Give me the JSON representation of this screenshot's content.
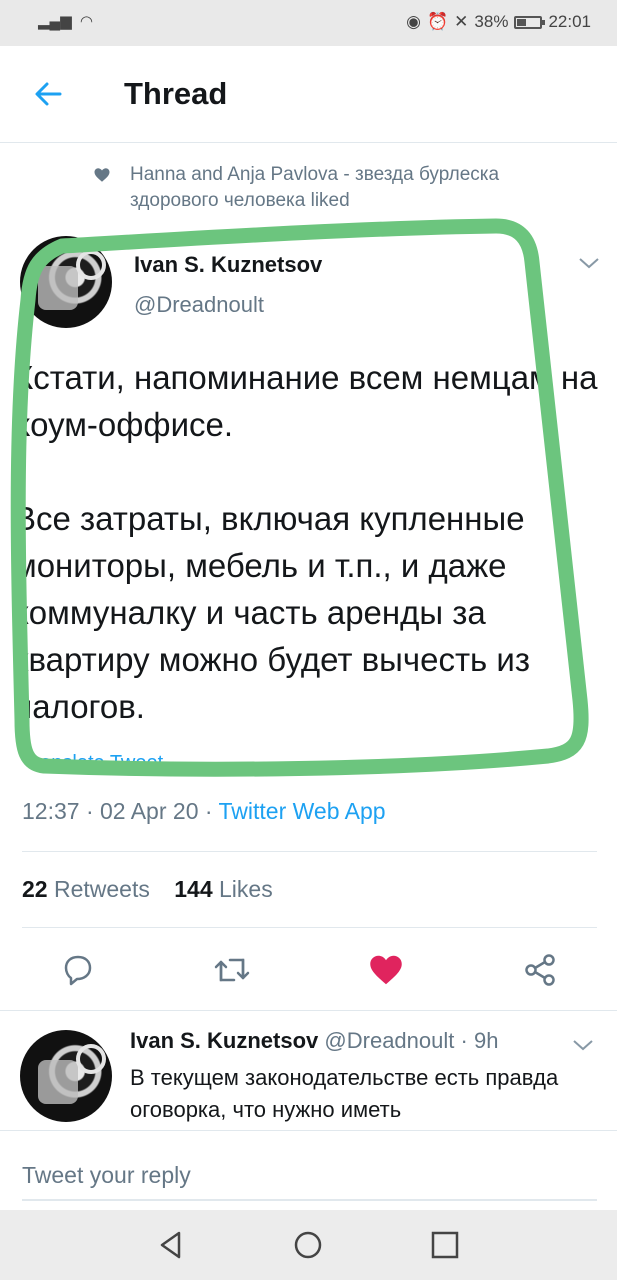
{
  "status_bar": {
    "signal": "..ıl",
    "battery_percent": "38%",
    "time": "22:01"
  },
  "header": {
    "title": "Thread"
  },
  "social_context": {
    "text": "Hanna and Anja Pavlova - звезда бурлеска здорового человека liked"
  },
  "tweet": {
    "author_name": "Ivan S. Kuznetsov",
    "author_handle": "@Dreadnoult",
    "text": "Кстати, напоминание всем немцам на хоум-оффисе.\n\nВсе затраты, включая купленные мониторы, мебель и т.п., и даже коммуналку и часть аренды за квартиру можно будет вычесть из налогов.",
    "translate_label": "Translate Tweet",
    "time": "12:37",
    "date": "02 Apr 20",
    "source": "Twitter Web App",
    "retweets": "22",
    "retweets_label": "Retweets",
    "likes": "144",
    "likes_label": "Likes",
    "liked": true
  },
  "reply": {
    "author_name": "Ivan S. Kuznetsov",
    "author_handle": "@Dreadnoult",
    "age": "9h",
    "text": "В текущем законодательстве есть правда оговорка, что нужно иметь"
  },
  "composer": {
    "placeholder": "Tweet your reply"
  },
  "colors": {
    "accent": "#1da1f2",
    "like": "#e0245e",
    "highlight": "#6cc57e",
    "secondary_text": "#657786"
  }
}
